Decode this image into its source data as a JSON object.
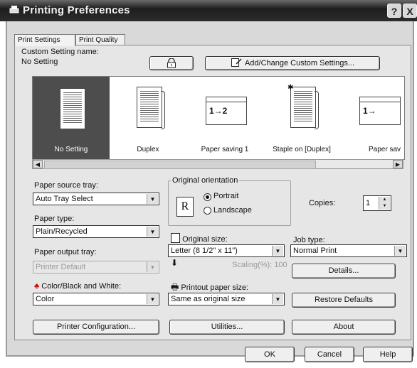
{
  "window": {
    "title": "Printing Preferences",
    "help_btn": "?",
    "close_btn": "X"
  },
  "tabs": [
    "Print Settings",
    "Print Quality"
  ],
  "custom_setting": {
    "label": "Custom Setting name:",
    "value": "No Setting",
    "add_change_label": "Add/Change Custom Settings..."
  },
  "presets": [
    {
      "label": "No Setting",
      "selected": true
    },
    {
      "label": "Duplex",
      "selected": false
    },
    {
      "label": "Paper saving 1",
      "selected": false
    },
    {
      "label": "Staple on [Duplex]",
      "selected": false
    },
    {
      "label": "Paper sav",
      "selected": false
    }
  ],
  "paper_source": {
    "label": "Paper source tray:",
    "value": "Auto Tray Select"
  },
  "paper_type": {
    "label": "Paper type:",
    "value": "Plain/Recycled"
  },
  "paper_output": {
    "label": "Paper output tray:",
    "value": "Printer Default"
  },
  "color_mode": {
    "label": "Color/Black and White:",
    "value": "Color"
  },
  "orientation": {
    "legend": "Original orientation",
    "portrait": "Portrait",
    "landscape": "Landscape",
    "selected": "Portrait"
  },
  "copies": {
    "label": "Copies:",
    "value": "1"
  },
  "original_size": {
    "label": "Original size:",
    "value": "Letter (8 1/2\" x 11\")"
  },
  "scaling": {
    "label": "Scaling(%):",
    "value": "100"
  },
  "printout_size": {
    "label": "Printout paper size:",
    "value": "Same as original size"
  },
  "job_type": {
    "label": "Job type:",
    "value": "Normal Print"
  },
  "buttons": {
    "details": "Details...",
    "restore_defaults": "Restore Defaults",
    "printer_configuration": "Printer Configuration...",
    "utilities": "Utilities...",
    "about": "About",
    "ok": "OK",
    "cancel": "Cancel",
    "help": "Help"
  }
}
